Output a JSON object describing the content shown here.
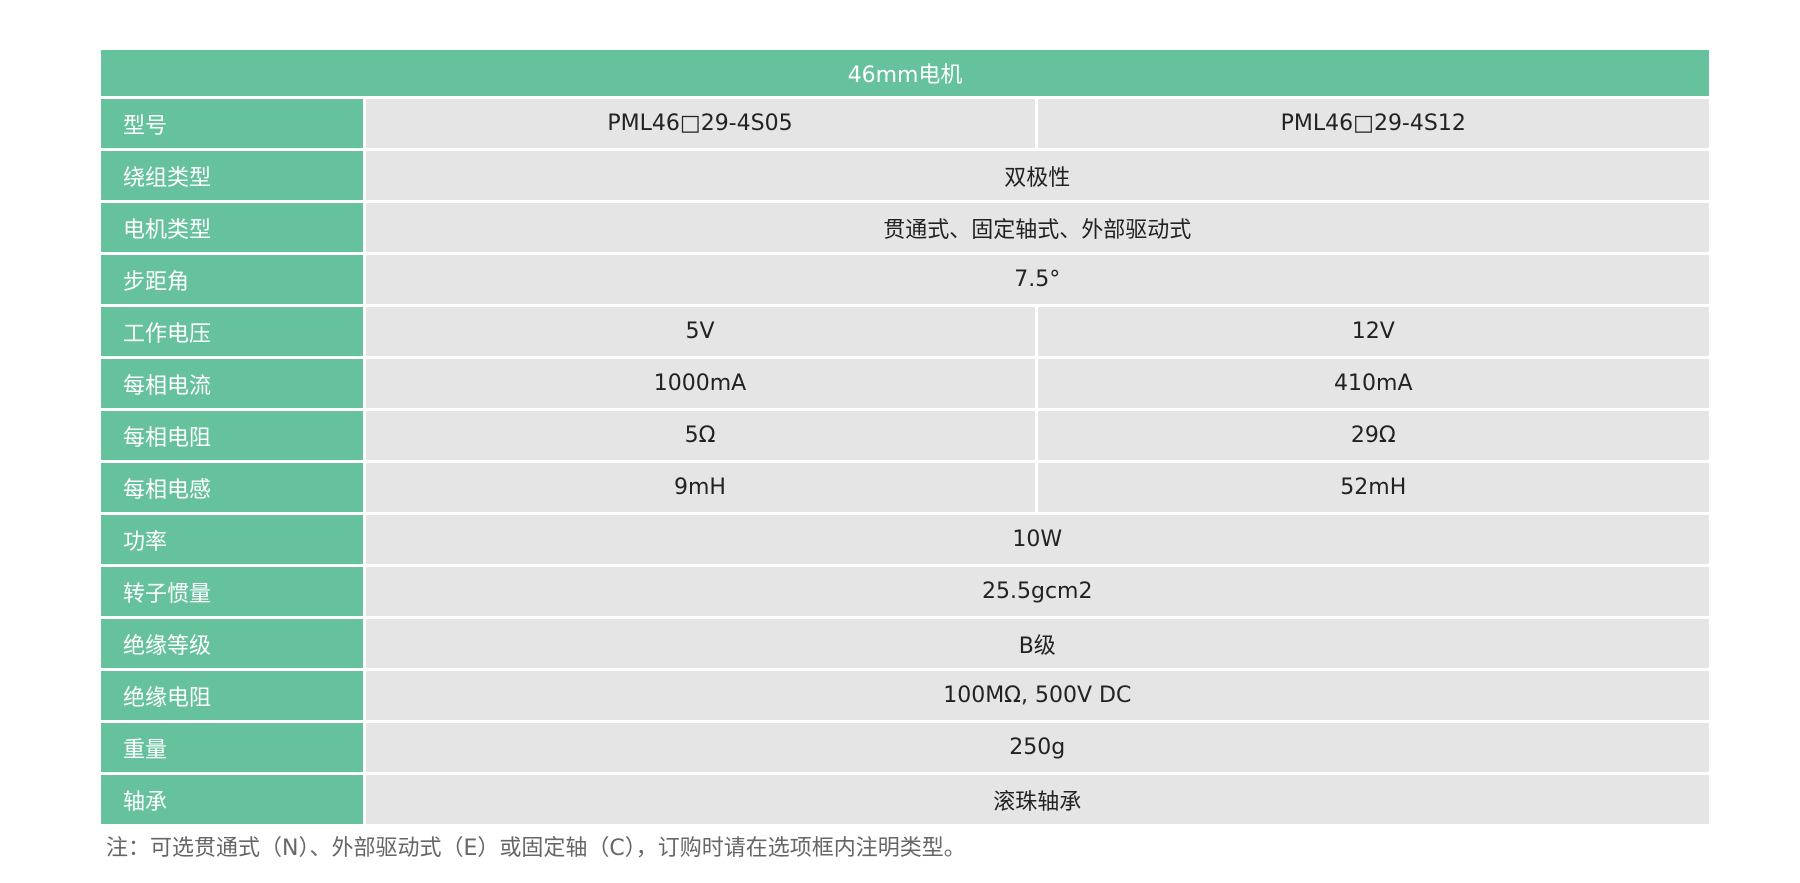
{
  "table": {
    "title": "46mm电机",
    "rows": [
      {
        "label": "型号",
        "values": [
          "PML46□29-4S05",
          "PML46□29-4S12"
        ]
      },
      {
        "label": "绕组类型",
        "values": [
          "双极性"
        ]
      },
      {
        "label": "电机类型",
        "values": [
          "贯通式、固定轴式、外部驱动式"
        ]
      },
      {
        "label": "步距角",
        "values": [
          "7.5°"
        ]
      },
      {
        "label": "工作电压",
        "values": [
          "5V",
          "12V"
        ]
      },
      {
        "label": "每相电流",
        "values": [
          "1000mA",
          "410mA"
        ]
      },
      {
        "label": "每相电阻",
        "values": [
          "5Ω",
          "29Ω"
        ]
      },
      {
        "label": "每相电感",
        "values": [
          "9mH",
          "52mH"
        ]
      },
      {
        "label": "功率",
        "values": [
          "10W"
        ]
      },
      {
        "label": "转子惯量",
        "values": [
          "25.5gcm2"
        ]
      },
      {
        "label": "绝缘等级",
        "values": [
          "B级"
        ]
      },
      {
        "label": "绝缘电阻",
        "values": [
          "100MΩ, 500V DC"
        ]
      },
      {
        "label": "重量",
        "values": [
          "250g"
        ]
      },
      {
        "label": "轴承",
        "values": [
          "滚珠轴承"
        ]
      }
    ]
  },
  "note": "注：可选贯通式（N）、外部驱动式（E）或固定轴（C），订购时请在选项框内注明类型。",
  "colors": {
    "header_green": "#66c29d",
    "cell_gray": "#e5e5e5"
  }
}
